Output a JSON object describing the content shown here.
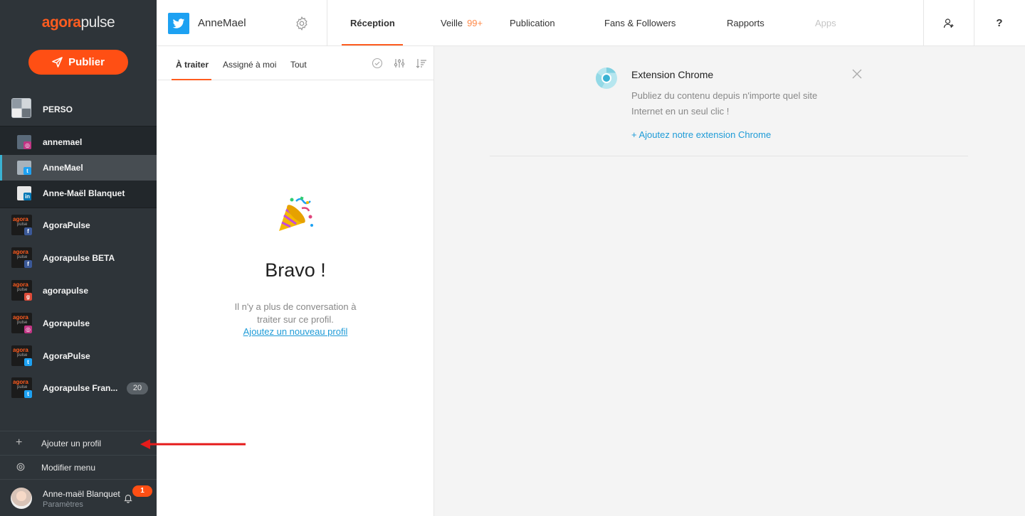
{
  "app": {
    "logo_part1": "agora",
    "logo_part2": "pulse",
    "publish_label": "Publier"
  },
  "sidebar": {
    "group_label": "PERSO",
    "sub_profiles": [
      {
        "label": "annemael",
        "network": "instagram"
      },
      {
        "label": "AnneMael",
        "network": "twitter",
        "active": true
      },
      {
        "label": "Anne-Maël Blanquet",
        "network": "linkedin"
      }
    ],
    "accounts": [
      {
        "label": "AgoraPulse",
        "network": "facebook",
        "network_glyph": "f"
      },
      {
        "label": "Agorapulse BETA",
        "network": "facebook",
        "network_glyph": "f"
      },
      {
        "label": "agorapulse",
        "network": "google-plus",
        "network_glyph": "g"
      },
      {
        "label": "Agorapulse",
        "network": "instagram",
        "network_glyph": "◎"
      },
      {
        "label": "AgoraPulse",
        "network": "twitter",
        "network_glyph": "t"
      },
      {
        "label": "Agorapulse Fran...",
        "network": "twitter",
        "network_glyph": "t",
        "count": "20"
      }
    ],
    "account_logo_text": "agora",
    "account_logo_sub": "pulse",
    "add_profile_label": "Ajouter un profil",
    "edit_menu_label": "Modifier menu",
    "user_name": "Anne-maël Blanquet",
    "user_sub": "Paramètres",
    "notification_count": "1"
  },
  "header": {
    "profile_name": "AnneMael",
    "tabs": [
      {
        "label": "Réception",
        "active": true
      },
      {
        "label": "Veille",
        "count": "99+"
      },
      {
        "label": "Publication"
      },
      {
        "label": "Fans & Followers"
      },
      {
        "label": "Rapports"
      },
      {
        "label": "Apps",
        "disabled": true
      }
    ],
    "help_label": "?"
  },
  "inbox": {
    "tabs": [
      "À traiter",
      "Assigné à moi",
      "Tout"
    ],
    "empty_title": "Bravo !",
    "empty_text": "Il n'y a plus de conversation à traiter sur ce profil.",
    "empty_link": "Ajoutez un nouveau profil"
  },
  "promo": {
    "title": "Extension Chrome",
    "description": "Publiez du contenu depuis n'importe quel site Internet en un seul clic !",
    "link": "+ Ajoutez notre extension Chrome"
  },
  "colors": {
    "accent": "#ff5c1f",
    "sidebar_bg": "#2e3439",
    "link": "#1e9bd7",
    "twitter": "#1da1f2"
  }
}
